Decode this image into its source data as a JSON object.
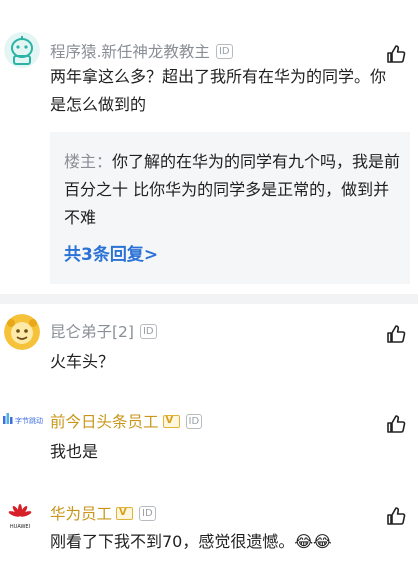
{
  "comments": [
    {
      "username": "程序猿.新任神龙教教主",
      "id_badge": "ID",
      "text": "两年拿这么多？超出了我所有在华为的同学。你是怎么做到的",
      "reply": {
        "author": "楼主：",
        "text": "你了解的在华为的同学有九个吗，我是前百分之十 比你华为的同学多是正常的，做到并不难",
        "more_label": "共3条回复>"
      }
    },
    {
      "username": "昆仑弟子[2]",
      "id_badge": "ID",
      "text": "火车头？"
    },
    {
      "username": "前今日头条员工",
      "avatar_label": "字节跳动",
      "id_badge": "ID",
      "text": "我也是"
    },
    {
      "username": "华为员工",
      "avatar_label": "HUAWEI",
      "id_badge": "ID",
      "text": "刚看了下我不到70，感觉很遗憾。😂😂"
    }
  ],
  "colors": {
    "username_gray": "#8a8f96",
    "username_gold": "#c8961a",
    "link_blue": "#2a72d6",
    "reply_bg": "#f5f6f8"
  },
  "icons": [
    "avatar-icon",
    "id-badge-icon",
    "verified-badge-icon",
    "thumbs-up-icon"
  ]
}
